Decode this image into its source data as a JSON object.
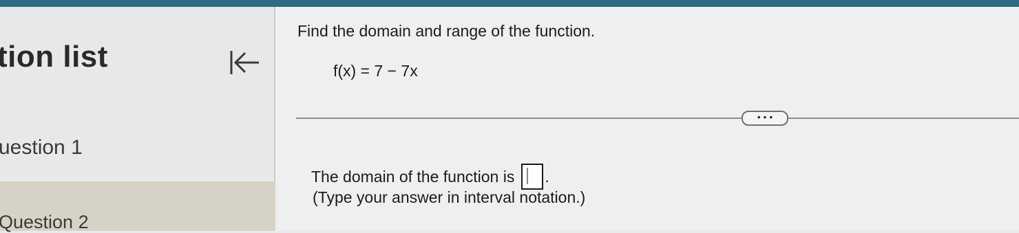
{
  "sidebar": {
    "title": "tion list",
    "questions": [
      {
        "label": "uestion 1"
      },
      {
        "label": "Question 2"
      }
    ],
    "collapse_icon": "collapse-left-icon"
  },
  "main": {
    "prompt": "Find the domain and range of the function.",
    "formula": "f(x) = 7 − 7x",
    "more_button": "• • •",
    "answer_prefix": "The domain of the function is",
    "answer_suffix": ".",
    "answer_value": "",
    "hint": "(Type your answer in interval notation.)"
  },
  "colors": {
    "topbar": "#2f6a86",
    "selected_row": "#d6d3c6"
  }
}
